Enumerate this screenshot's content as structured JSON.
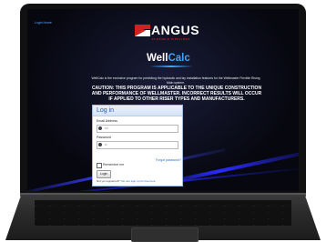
{
  "screen": {
    "top_link": "Login Home",
    "angus_logo": {
      "word": "ANGUS",
      "tagline": "FLEXIBLE PIPELINES",
      "accent": "#cc2222"
    },
    "wellcalc_logo": {
      "prefix": "Well",
      "suffix": "Calc",
      "accent": "#3ea6ff"
    },
    "description": "WellCalc is the exclusive program for predicting the hydraulic and lay installation features for the Wellmaster Flexible Rising Main system.",
    "caution": "CAUTION: THIS PROGRAM IS APPLICABLE TO THE UNIQUE CONSTRUCTION AND PERFORMANCE OF WELLMASTER. INCORRECT RESULTS WILL OCCUR IF APPLIED TO OTHER RISER TYPES AND MANUFACTURERS."
  },
  "login": {
    "title": "Log in",
    "email_label": "Email Address",
    "email_value": "•••",
    "password_label": "Password",
    "password_value": "••",
    "forgot_label": "Forgot password?",
    "remember_label": "Remember me",
    "button_label": "Login",
    "register_prefix": "Not yet registered?",
    "register_link": "You can sign up for free here"
  }
}
